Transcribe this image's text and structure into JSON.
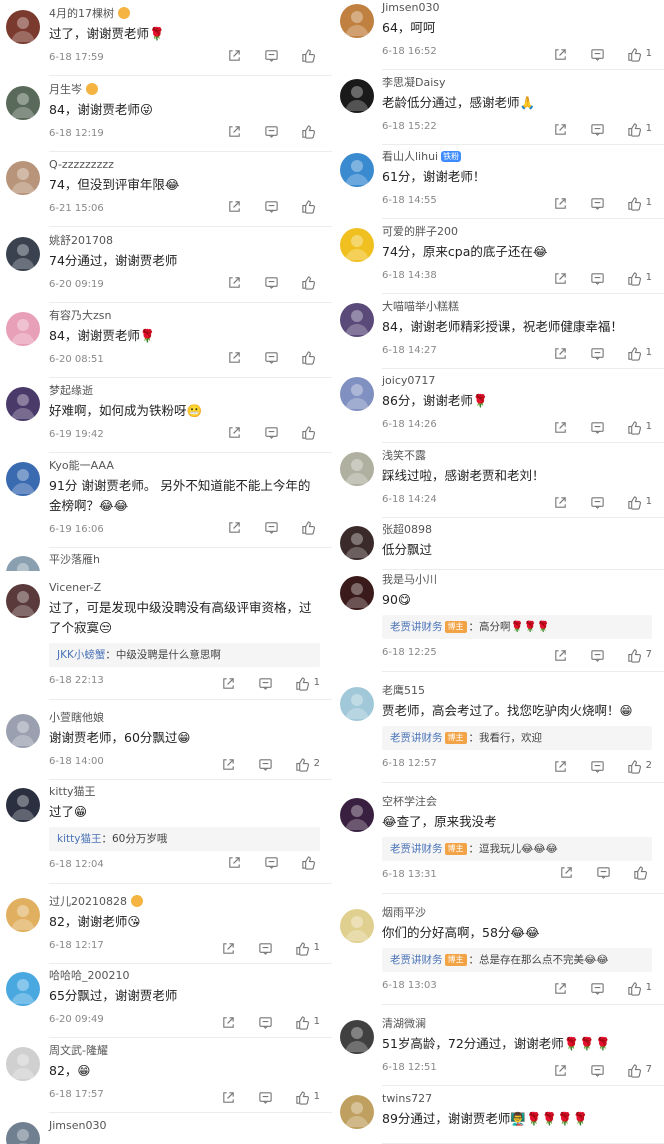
{
  "left_top": [
    {
      "name": "4月的17棵树",
      "medal": true,
      "text": "过了，谢谢贾老师🌹",
      "date": "6-18 17:59",
      "likes": "",
      "avatar_color": "#7a3a2e"
    },
    {
      "name": "月生岑",
      "medal": true,
      "text": "84，谢谢贾老师😜",
      "date": "6-18 12:19",
      "likes": "",
      "avatar_color": "#5a6a5a"
    },
    {
      "name": "Q-zzzzzzzzz",
      "text": "74，但没到评审年限😂",
      "date": "6-21 15:06",
      "likes": "",
      "avatar_color": "#b8957a"
    },
    {
      "name": "姚舒201708",
      "text": "74分通过，谢谢贾老师",
      "date": "6-20 09:19",
      "likes": "",
      "avatar_color": "#3a4250"
    },
    {
      "name": "有容乃大zsn",
      "text": "84，谢谢贾老师🌹",
      "date": "6-20 08:51",
      "likes": "",
      "avatar_color": "#e8a0b8"
    },
    {
      "name": "梦起缘逝",
      "text": "好难啊，如何成为铁粉呀😬",
      "date": "6-19 19:42",
      "likes": "",
      "avatar_color": "#4a3a6a"
    },
    {
      "name": "Kyo能一AAA",
      "text": "91分 谢谢贾老师。 另外不知道能不能上今年的金榜啊？😂😂",
      "date": "6-19 16:06",
      "likes": "",
      "avatar_color": "#3a6ab0"
    },
    {
      "name": "平沙落雁h",
      "avatar_color": "#8aa0b0"
    }
  ],
  "left_bottom": [
    {
      "name": "Vicener-Z",
      "text": "过了，可是发现中级没聘没有高级评审资格，过了个寂寞😒",
      "reply_name": "JKK小螃蟹",
      "reply_tag": "",
      "reply_text": "：中级没聘是什么意思啊",
      "date": "6-18 22:13",
      "likes": "1",
      "avatar_color": "#5a3a3a"
    },
    {
      "name": "小萱瞎他娘",
      "text": "谢谢贾老师，60分飘过😁",
      "date": "6-18 14:00",
      "likes": "2",
      "avatar_color": "#9aa0b0"
    },
    {
      "name": "kitty猫王",
      "text": "过了😁",
      "reply_name": "kitty猫王",
      "reply_tag": "",
      "reply_text": "：60分万岁哦",
      "date": "6-18 12:04",
      "likes": "",
      "avatar_color": "#2a3040"
    },
    {
      "name": "过儿20210828",
      "medal": true,
      "text": "82，谢谢老师😘",
      "date": "6-18 12:17",
      "likes": "1",
      "avatar_color": "#e0b060"
    },
    {
      "name": "哈哈哈_200210",
      "text": "65分飘过，谢谢贾老师",
      "date": "6-20 09:49",
      "likes": "1",
      "avatar_color": "#4aa8e0"
    },
    {
      "name": "周文武-隆耀",
      "text": "82，😁",
      "date": "6-18 17:57",
      "likes": "1",
      "avatar_color": "#d0d0d0"
    },
    {
      "name": "Jimsen030",
      "avatar_color": "#708090"
    }
  ],
  "right_top": [
    {
      "name": "Jimsen030",
      "text": "64，呵呵",
      "date": "6-18 16:52",
      "likes": "1",
      "avatar_color": "#c08040"
    },
    {
      "name": "李思凝Daisy",
      "text": "老龄低分通过，感谢老师🙏",
      "date": "6-18 15:22",
      "likes": "1",
      "avatar_color": "#1a1a1a"
    },
    {
      "name": "看山人lihui",
      "vbadge": "铁粉",
      "text": "61分，谢谢老师！",
      "date": "6-18 14:55",
      "likes": "1",
      "avatar_color": "#3a8ad0"
    },
    {
      "name": "可爱的胖子200",
      "text": "74分，原来cpa的底子还在😂",
      "date": "6-18 14:38",
      "likes": "1",
      "avatar_color": "#f0c020"
    },
    {
      "name": "大喵喵举小糕糕",
      "text": "84，谢谢老师精彩授课，祝老师健康幸福！",
      "date": "6-18 14:27",
      "likes": "1",
      "avatar_color": "#5a4a7a"
    },
    {
      "name": "joicy0717",
      "text": "86分，谢谢老师🌹",
      "date": "6-18 14:26",
      "likes": "1",
      "avatar_color": "#8090c0"
    },
    {
      "name": "浅笑不露",
      "text": "踩线过啦，感谢老贾和老刘！",
      "date": "6-18 14:24",
      "likes": "1",
      "avatar_color": "#b0b0a0"
    },
    {
      "name": "张超0898",
      "text": "低分飘过",
      "date": "",
      "likes": "",
      "avatar_color": "#3a2a2a"
    }
  ],
  "right_bottom": [
    {
      "name": "我是马小川",
      "text": "90😋",
      "reply_name": "老贾讲财务",
      "reply_tag": "博主",
      "reply_text": "：高分啊🌹🌹🌹",
      "date": "6-18 12:25",
      "likes": "7",
      "avatar_color": "#3a1a1a"
    },
    {
      "name": "老鹰515",
      "text": "贾老师，高会考过了。找您吃驴肉火烧啊！😁",
      "reply_name": "老贾讲财务",
      "reply_tag": "博主",
      "reply_text": "：我看行，欢迎",
      "date": "6-18 12:57",
      "likes": "2",
      "avatar_color": "#a0c8d8"
    },
    {
      "name": "空杯学注会",
      "text": "😂查了，原来我没考",
      "reply_name": "老贾讲财务",
      "reply_tag": "博主",
      "reply_text": "：逗我玩儿😂😂😂",
      "date": "6-18 13:31",
      "likes": "",
      "avatar_color": "#3a2040"
    },
    {
      "name": "烟雨平沙",
      "text": "你们的分好高啊，58分😂😂",
      "reply_name": "老贾讲财务",
      "reply_tag": "博主",
      "reply_text": "：总是存在那么点不完美😂😂",
      "date": "6-18 13:03",
      "likes": "1",
      "avatar_color": "#e0d090"
    },
    {
      "name": "清湖微澜",
      "text": "51岁高龄，72分通过，谢谢老师🌹🌹🌹",
      "date": "6-18 12:51",
      "likes": "7",
      "avatar_color": "#404040"
    },
    {
      "name": "twins727",
      "text": "89分通过，谢谢贾老师👨‍🏫🌹🌹🌹🌹",
      "date": "",
      "likes": "",
      "avatar_color": "#c0a060"
    }
  ]
}
